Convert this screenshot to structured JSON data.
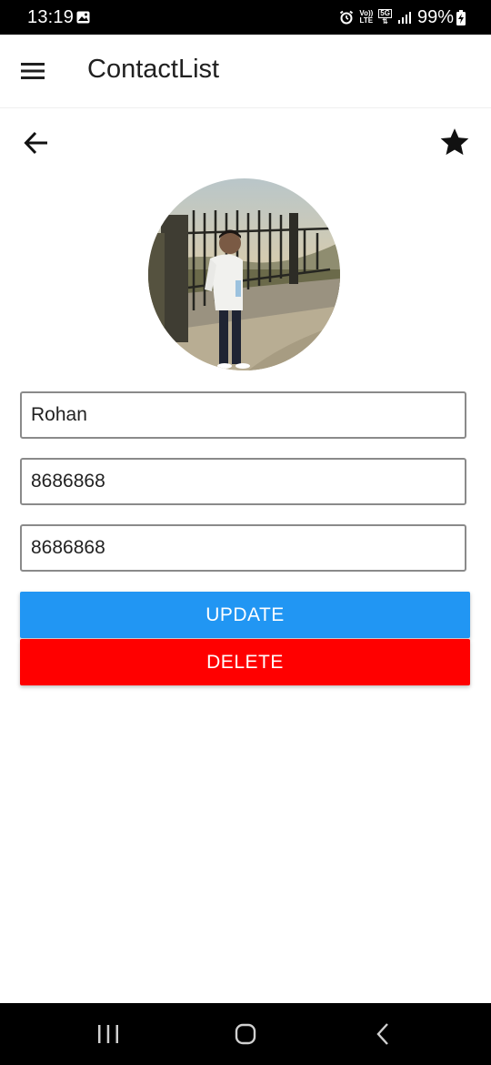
{
  "status_bar": {
    "time": "13:19",
    "network_top": "Vo))",
    "network_bottom": "LTE",
    "network_5g": "5G",
    "battery": "99%"
  },
  "app_bar": {
    "title": "ContactList"
  },
  "contact": {
    "name": "Rohan",
    "phone1": "8686868",
    "phone2": "8686868"
  },
  "buttons": {
    "update": "UPDATE",
    "delete": "DELETE"
  },
  "colors": {
    "update": "#2196f3",
    "delete": "#ff0000"
  }
}
